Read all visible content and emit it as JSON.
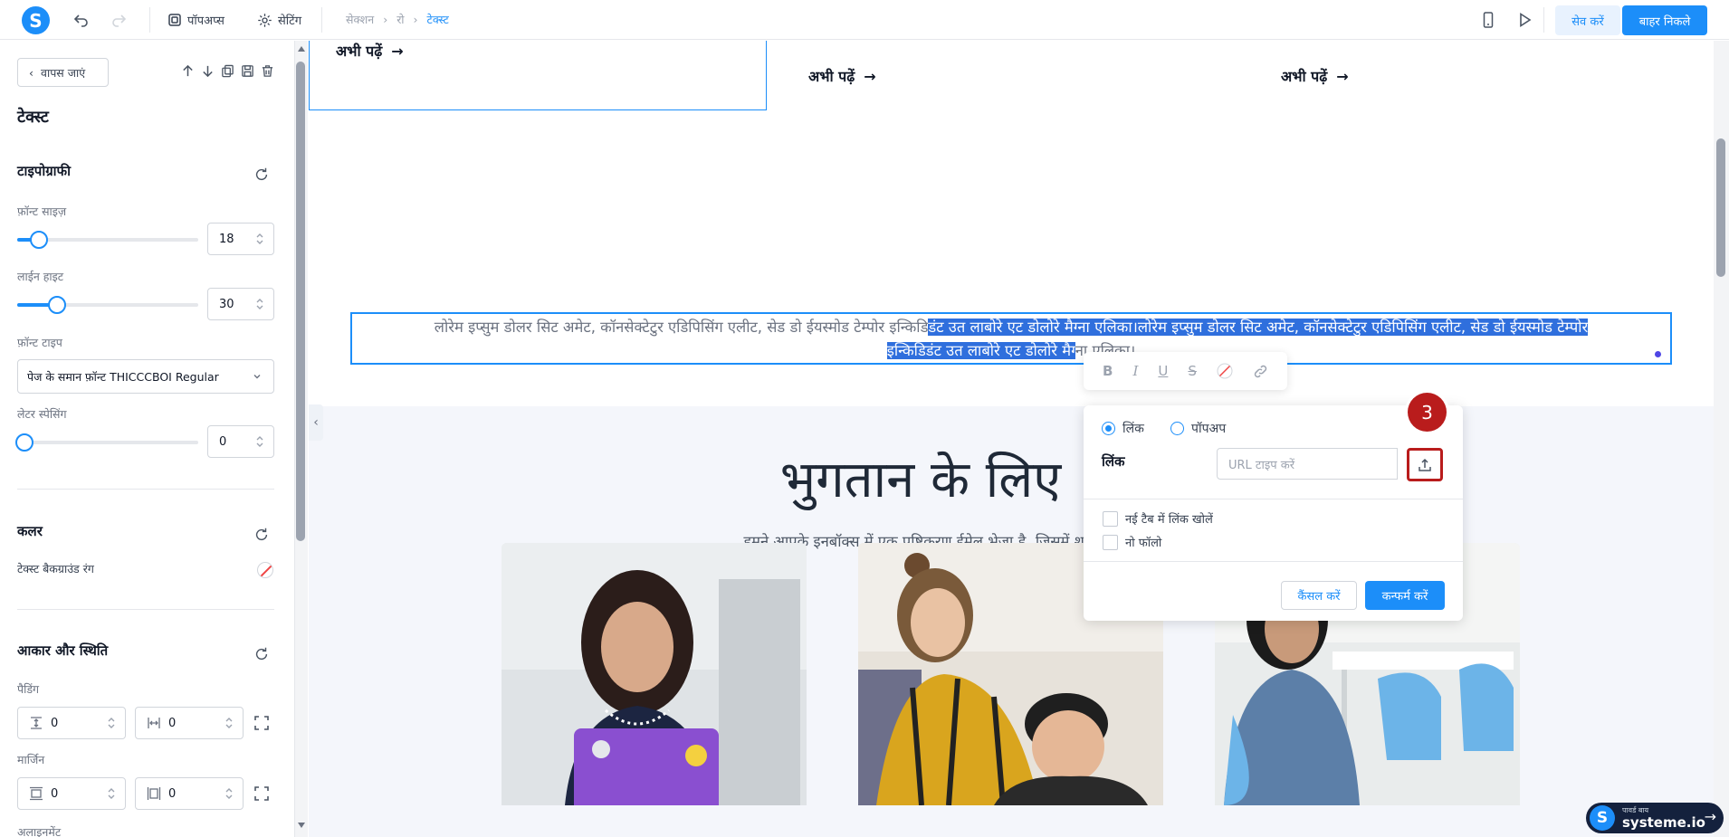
{
  "topbar": {
    "logo_letter": "S",
    "popups_label": "पॉपअप्स",
    "settings_label": "सेटिंग",
    "breadcrumb": [
      "सेक्शन",
      "रो",
      "टेक्स्ट"
    ],
    "save_label": "सेव करें",
    "exit_label": "बाहर निकले",
    "accent_color": "#1c8ef9"
  },
  "sidebar": {
    "back_label": "वापस जाएं",
    "title": "टेक्स्ट",
    "typography": {
      "title": "टाइपोग्राफी",
      "font_size_label": "फ़ॉन्ट साइज़",
      "font_size": "18",
      "font_size_level": 0.12,
      "line_height_label": "लाईन हाइट",
      "line_height": "30",
      "line_height_level": 0.22,
      "font_type_label": "फ़ॉन्ट टाइप",
      "font_type": "पेज के समान फ़ॉन्ट THICCCBOI Regular",
      "letter_spacing_label": "लेटर स्पेसिंग",
      "letter_spacing": "0",
      "letter_spacing_level": 0
    },
    "color": {
      "title": "कलर",
      "bg_label": "टेक्स्ट बैकग्राउंड रंग"
    },
    "size_position": {
      "title": "आकार और स्थिति",
      "padding_label": "पैडिंग",
      "padding_vertical": "0",
      "padding_horizontal": "0",
      "margin_label": "मार्जिन",
      "margin_vertical": "0",
      "margin_horizontal": "0",
      "alignment_label": "अलाइनमेंट"
    }
  },
  "canvas": {
    "read_more": "अभी पढ़ें",
    "text_plain": "लोरेम इप्सुम डोलर सिट अमेट, कॉनसेक्टेटुर एडिपिसिंग एलीट, सेड डो ईयस्मोड टेम्पोर इन्किडि",
    "text_selected_1": "डंट उत लाबोरे एट डोलोरे मैग्ना एलिका।लोरेम इप्सुम डोलर सिट अमेट, कॉनसेक्टेटुर एडिपिसिंग एलीट, सेड डो ईयस्मोड टेम्पोर",
    "text_selected_2": "इन्किडिडंट उत लाबोरे एट डोलोरे मैग्",
    "text_tail": "ना एलिका।",
    "payment_title": "भुगतान के लिए",
    "payment_subtitle": "हमने आपके इनबॉक्स में एक पुष्टिकरण ईमेल भेजा है, जिसमें शुरू"
  },
  "link_popup": {
    "radio_link": "लिंक",
    "radio_popup": "पॉपअप",
    "link_label": "लिंक",
    "url_placeholder": "URL टाइप करें",
    "new_tab_label": "नई टैब में लिंक खोलें",
    "nofollow_label": "नो फॉलो",
    "cancel_label": "कैंसल करें",
    "confirm_label": "कन्फर्म करें"
  },
  "step_badge": "3",
  "powered": {
    "small_text": "पावर्ड बाय",
    "brand": "systeme.io"
  }
}
